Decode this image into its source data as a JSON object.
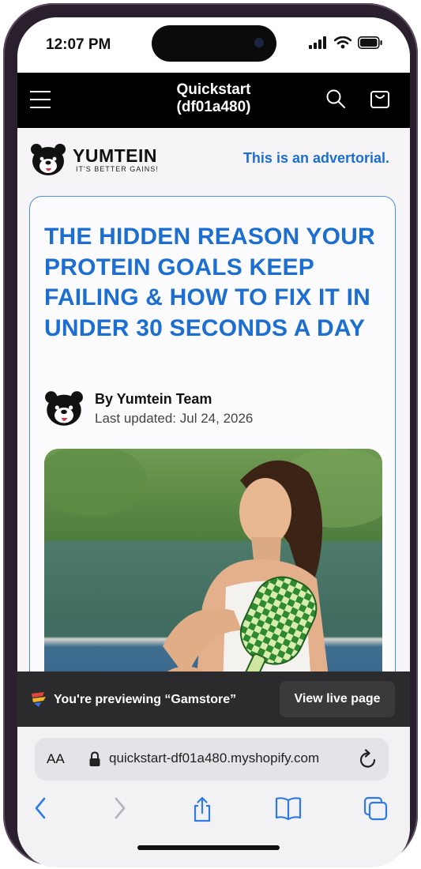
{
  "status": {
    "time": "12:07 PM"
  },
  "header": {
    "title_line1": "Quickstart",
    "title_line2": "(df01a480)",
    "icons": [
      "menu-icon",
      "search-icon",
      "cart-icon"
    ]
  },
  "brand": {
    "name": "YUMTEIN",
    "tagline": "IT'S BETTER GAINS!",
    "advertorial_notice": "This is an advertorial."
  },
  "article": {
    "headline": "THE HIDDEN REASON YOUR PROTEIN GOALS KEEP FAILING & HOW TO FIX IT IN UNDER 30 SECONDS A DAY",
    "author": "By Yumtein Team",
    "updated": "Last updated: Jul 24, 2026"
  },
  "preview": {
    "text": "You're previewing “Gamstore”",
    "button": "View live page"
  },
  "browser": {
    "aa": "AA",
    "url": "quickstart-df01a480.myshopify.com",
    "toolbar_icons": [
      "back-icon",
      "forward-icon",
      "share-icon",
      "bookmarks-icon",
      "tabs-icon"
    ]
  },
  "colors": {
    "accent": "#1c6fd0",
    "header_bg": "#000000",
    "preview_bg": "#2b2b2d"
  }
}
